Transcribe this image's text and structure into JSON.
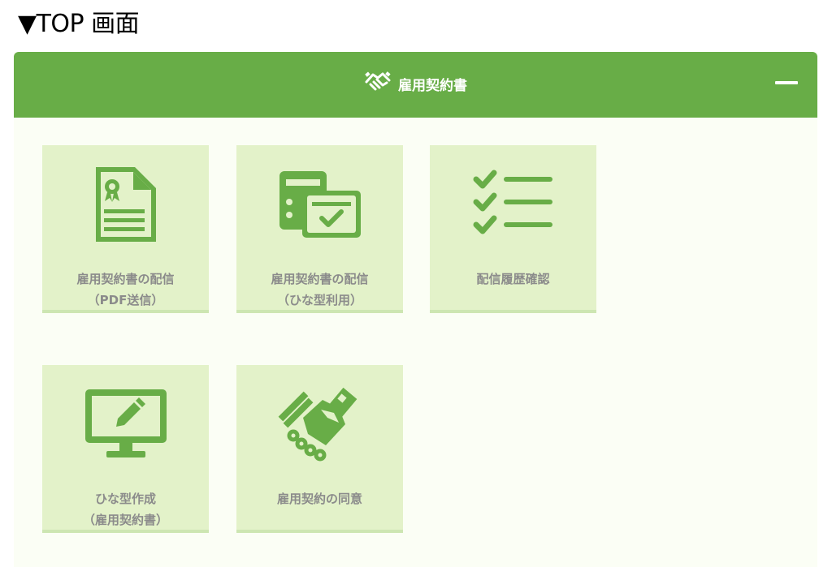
{
  "page_caption": "▼TOP 画面",
  "panel": {
    "title": "雇用契約書",
    "title_icon": "handshake-icon",
    "collapse_icon": "minus-icon"
  },
  "tiles": [
    {
      "line1": "雇用契約書の配信",
      "line2": "（PDF送信）",
      "icon": "certificate-document-icon"
    },
    {
      "line1": "雇用契約書の配信",
      "line2": "（ひな型利用）",
      "icon": "template-check-icon"
    },
    {
      "line1": "配信履歴確認",
      "line2": "",
      "icon": "checklist-icon"
    },
    {
      "line1": "ひな型作成",
      "line2": "（雇用契約書）",
      "icon": "monitor-pencil-icon"
    },
    {
      "line1": "雇用契約の同意",
      "line2": "",
      "icon": "handshake-icon"
    }
  ],
  "colors": {
    "header": "#68ad47",
    "tile_bg": "#e3f2c9",
    "icon": "#68ad47",
    "label": "#8b8b8b"
  }
}
